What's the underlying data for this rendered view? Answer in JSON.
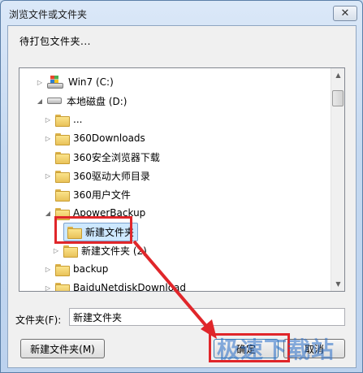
{
  "window": {
    "title": "浏览文件或文件夹",
    "close_glyph": "✕"
  },
  "prompt": "待打包文件夹...",
  "tree": {
    "items": [
      {
        "label": "Win7 (C:)",
        "icon": "windows-drive-icon",
        "expander": "▷"
      },
      {
        "label": "本地磁盘 (D:)",
        "icon": "drive-icon",
        "expander": "◢"
      },
      {
        "label": "...",
        "icon": "folder-icon",
        "expander": "▷"
      },
      {
        "label": "360Downloads",
        "icon": "folder-icon",
        "expander": "▷"
      },
      {
        "label": "360安全浏览器下载",
        "icon": "folder-icon",
        "expander": ""
      },
      {
        "label": "360驱动大师目录",
        "icon": "folder-icon",
        "expander": "▷"
      },
      {
        "label": "360用户文件",
        "icon": "folder-icon",
        "expander": ""
      },
      {
        "label": "ApowerBackup",
        "icon": "folder-icon",
        "expander": "◢"
      },
      {
        "label": "新建文件夹",
        "icon": "folder-icon",
        "expander": "",
        "selected": true
      },
      {
        "label": "新建文件夹 (2)",
        "icon": "folder-icon",
        "expander": "▷"
      },
      {
        "label": "backup",
        "icon": "folder-icon",
        "expander": "▷"
      },
      {
        "label": "BaiduNetdiskDownload",
        "icon": "folder-icon",
        "expander": "▷"
      }
    ]
  },
  "folder_field": {
    "label": "文件夹(F):",
    "value": "新建文件夹"
  },
  "buttons": {
    "new_folder": "新建文件夹(M)",
    "ok": "确定",
    "cancel": "取消"
  },
  "watermark": "极速下载站",
  "colors": {
    "annotation_red": "#e0262a",
    "selection": "#cde8ff"
  }
}
